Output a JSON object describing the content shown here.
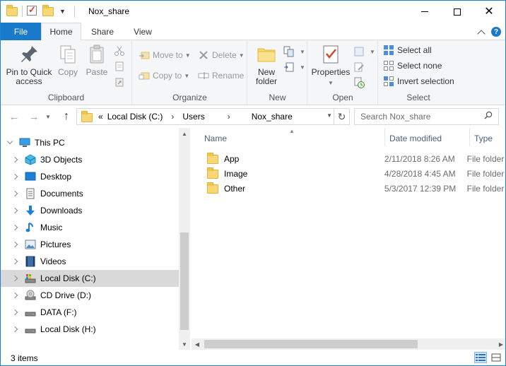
{
  "window": {
    "title": "Nox_share",
    "controls": {
      "minimize": "minimize-icon",
      "maximize": "maximize-icon",
      "close": "close-icon"
    }
  },
  "tabs": {
    "file": "File",
    "home": "Home",
    "share": "Share",
    "view": "View"
  },
  "ribbon": {
    "clipboard": {
      "label": "Clipboard",
      "pin": "Pin to Quick access",
      "pin_line1": "Pin to Quick",
      "pin_line2": "access",
      "copy": "Copy",
      "paste": "Paste"
    },
    "organize": {
      "label": "Organize",
      "move_to": "Move to",
      "copy_to": "Copy to",
      "delete": "Delete",
      "rename": "Rename"
    },
    "new": {
      "label": "New",
      "new_folder_line1": "New",
      "new_folder_line2": "folder"
    },
    "open": {
      "label": "Open",
      "properties": "Properties"
    },
    "select": {
      "label": "Select",
      "select_all": "Select all",
      "select_none": "Select none",
      "invert": "Invert selection"
    }
  },
  "address": {
    "overflow": "«",
    "crumbs": [
      "Local Disk (C:)",
      "Users",
      "Nox_share"
    ],
    "search_placeholder": "Search Nox_share"
  },
  "nav_tree": [
    {
      "label": "This PC",
      "icon": "this-pc-icon",
      "expanded": true
    },
    {
      "label": "3D Objects",
      "icon": "3d-objects-icon"
    },
    {
      "label": "Desktop",
      "icon": "desktop-icon"
    },
    {
      "label": "Documents",
      "icon": "documents-icon"
    },
    {
      "label": "Downloads",
      "icon": "downloads-icon"
    },
    {
      "label": "Music",
      "icon": "music-icon"
    },
    {
      "label": "Pictures",
      "icon": "pictures-icon"
    },
    {
      "label": "Videos",
      "icon": "videos-icon"
    },
    {
      "label": "Local Disk (C:)",
      "icon": "local-disk-icon",
      "selected": true
    },
    {
      "label": "CD Drive (D:)",
      "icon": "cd-drive-icon"
    },
    {
      "label": "DATA (F:)",
      "icon": "drive-icon"
    },
    {
      "label": "Local Disk (H:)",
      "icon": "drive-icon"
    }
  ],
  "columns": {
    "name": "Name",
    "date": "Date modified",
    "type": "Type"
  },
  "files": [
    {
      "name": "App",
      "date": "2/11/2018 8:26 AM",
      "type": "File folder"
    },
    {
      "name": "Image",
      "date": "4/28/2018 4:45 AM",
      "type": "File folder"
    },
    {
      "name": "Other",
      "date": "5/3/2017 12:39 PM",
      "type": "File folder"
    }
  ],
  "status": {
    "items": "3 items"
  },
  "colors": {
    "accent": "#1979ca",
    "selection": "#cce8ff",
    "folder": "#f8d775"
  }
}
